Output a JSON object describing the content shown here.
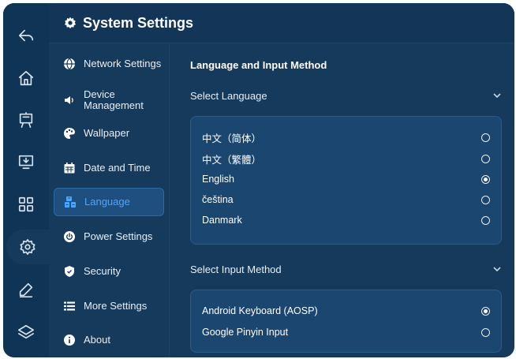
{
  "header": {
    "title": "System Settings",
    "icon": "gear-icon"
  },
  "rail": {
    "items": [
      {
        "name": "back-icon"
      },
      {
        "name": "home-icon"
      },
      {
        "name": "easel-icon"
      },
      {
        "name": "monitor-download-icon"
      },
      {
        "name": "apps-grid-icon"
      },
      {
        "name": "settings-gear-icon",
        "active": true
      },
      {
        "name": "pen-icon"
      },
      {
        "name": "layers-icon"
      }
    ]
  },
  "menu": {
    "items": [
      {
        "label": "Network Settings",
        "icon": "globe-icon"
      },
      {
        "label": "Device Management",
        "icon": "speaker-icon"
      },
      {
        "label": "Wallpaper",
        "icon": "palette-icon"
      },
      {
        "label": "Date and Time",
        "icon": "calendar-icon"
      },
      {
        "label": "Language",
        "icon": "language-icon",
        "active": true
      },
      {
        "label": "Power Settings",
        "icon": "power-icon"
      },
      {
        "label": "Security",
        "icon": "shield-icon"
      },
      {
        "label": "More Settings",
        "icon": "list-icon"
      },
      {
        "label": "About",
        "icon": "info-icon"
      }
    ]
  },
  "content": {
    "section_title": "Language and Input Method",
    "language": {
      "label": "Select Language",
      "options": [
        {
          "label": "中文（简体）",
          "selected": false
        },
        {
          "label": "中文（繁體）",
          "selected": false
        },
        {
          "label": "English",
          "selected": true
        },
        {
          "label": "čeština",
          "selected": false
        },
        {
          "label": "Danmark",
          "selected": false
        }
      ]
    },
    "input_method": {
      "label": "Select Input Method",
      "options": [
        {
          "label": "Android Keyboard (AOSP)",
          "selected": true
        },
        {
          "label": "Google Pinyin Input",
          "selected": false
        }
      ]
    }
  },
  "colors": {
    "background": "#163a5c",
    "rail": "#0f3456",
    "accent": "#4aa6ff",
    "card": "#1b4670"
  }
}
